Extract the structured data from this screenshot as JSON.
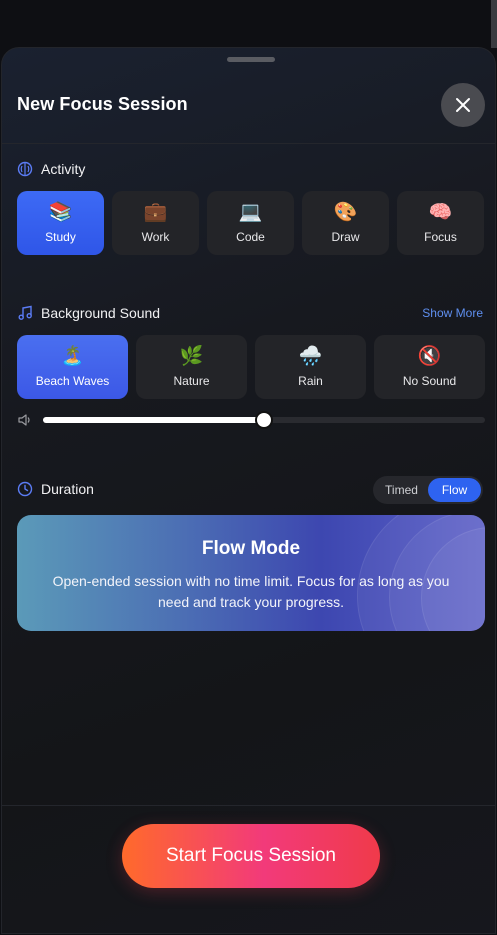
{
  "sheet": {
    "title": "New Focus Session"
  },
  "activity": {
    "label": "Activity",
    "options": [
      {
        "emoji": "📚",
        "label": "Study",
        "active": true
      },
      {
        "emoji": "💼",
        "label": "Work",
        "active": false
      },
      {
        "emoji": "💻",
        "label": "Code",
        "active": false
      },
      {
        "emoji": "🎨",
        "label": "Draw",
        "active": false
      },
      {
        "emoji": "🧠",
        "label": "Focus",
        "active": false
      }
    ]
  },
  "sound": {
    "label": "Background Sound",
    "show_more": "Show More",
    "options": [
      {
        "emoji": "🏝️",
        "label": "Beach Waves",
        "active": true
      },
      {
        "emoji": "🌿",
        "label": "Nature",
        "active": false
      },
      {
        "emoji": "🌧️",
        "label": "Rain",
        "active": false
      },
      {
        "emoji": "🔇",
        "label": "No Sound",
        "active": false
      }
    ],
    "volume": 0.5
  },
  "duration": {
    "label": "Duration",
    "toggle": [
      {
        "label": "Timed",
        "active": false
      },
      {
        "label": "Flow",
        "active": true
      }
    ],
    "flow_card": {
      "title": "Flow Mode",
      "description": "Open-ended session with no time limit. Focus for as long as you need and track your progress."
    }
  },
  "start_button": "Start Focus Session",
  "colors": {
    "accent": "#2e63f0",
    "link": "#5f8ff0",
    "start_gradient_from": "#ff6a2b",
    "start_gradient_to": "#f03a4a"
  }
}
